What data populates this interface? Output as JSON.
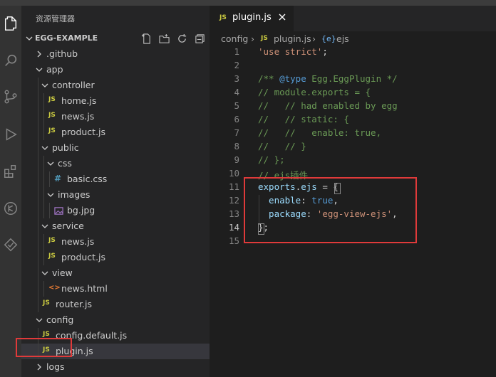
{
  "explorer": {
    "title": "资源管理器",
    "root": "EGG-EXAMPLE"
  },
  "tree": [
    {
      "name": ".github",
      "icon": "folder",
      "expanded": false,
      "depth": 0
    },
    {
      "name": "app",
      "icon": "folder",
      "expanded": true,
      "depth": 0
    },
    {
      "name": "controller",
      "icon": "folder",
      "expanded": true,
      "depth": 1
    },
    {
      "name": "home.js",
      "icon": "js",
      "depth": 2
    },
    {
      "name": "news.js",
      "icon": "js",
      "depth": 2
    },
    {
      "name": "product.js",
      "icon": "js",
      "depth": 2
    },
    {
      "name": "public",
      "icon": "folder",
      "expanded": true,
      "depth": 1
    },
    {
      "name": "css",
      "icon": "folder",
      "expanded": true,
      "depth": 2
    },
    {
      "name": "basic.css",
      "icon": "css",
      "depth": 3
    },
    {
      "name": "images",
      "icon": "folder",
      "expanded": true,
      "depth": 2
    },
    {
      "name": "bg.jpg",
      "icon": "image",
      "depth": 3
    },
    {
      "name": "service",
      "icon": "folder",
      "expanded": true,
      "depth": 1
    },
    {
      "name": "news.js",
      "icon": "js",
      "depth": 2
    },
    {
      "name": "product.js",
      "icon": "js",
      "depth": 2
    },
    {
      "name": "view",
      "icon": "folder",
      "expanded": true,
      "depth": 1
    },
    {
      "name": "news.html",
      "icon": "html",
      "depth": 2
    },
    {
      "name": "router.js",
      "icon": "js",
      "depth": 1
    },
    {
      "name": "config",
      "icon": "folder",
      "expanded": true,
      "depth": 0
    },
    {
      "name": "config.default.js",
      "icon": "js",
      "depth": 1
    },
    {
      "name": "plugin.js",
      "icon": "js",
      "depth": 1,
      "selected": true
    },
    {
      "name": "logs",
      "icon": "folder",
      "expanded": false,
      "depth": 0
    }
  ],
  "tab": {
    "js_badge": "JS",
    "name": "plugin.js"
  },
  "breadcrumb": {
    "folder": "config",
    "sep": "›",
    "js_badge": "JS",
    "file": "plugin.js",
    "symbol_icon": "{e}",
    "symbol": "ejs"
  },
  "code": [
    {
      "n": "1",
      "tokens": [
        {
          "t": "'use strict'",
          "c": "c-str"
        },
        {
          "t": ";",
          "c": "c-pn"
        }
      ]
    },
    {
      "n": "2",
      "tokens": []
    },
    {
      "n": "3",
      "tokens": [
        {
          "t": "/** ",
          "c": "c-com"
        },
        {
          "t": "@type",
          "c": "c-doc"
        },
        {
          "t": " Egg.EggPlugin */",
          "c": "c-com"
        }
      ]
    },
    {
      "n": "4",
      "tokens": [
        {
          "t": "// module.exports = {",
          "c": "c-com"
        }
      ]
    },
    {
      "n": "5",
      "tokens": [
        {
          "t": "//   // had enabled by egg",
          "c": "c-com"
        }
      ]
    },
    {
      "n": "6",
      "tokens": [
        {
          "t": "//   // static: {",
          "c": "c-com"
        }
      ]
    },
    {
      "n": "7",
      "tokens": [
        {
          "t": "//   //   enable: true,",
          "c": "c-com"
        }
      ]
    },
    {
      "n": "8",
      "tokens": [
        {
          "t": "//   // }",
          "c": "c-com"
        }
      ]
    },
    {
      "n": "9",
      "tokens": [
        {
          "t": "// };",
          "c": "c-com"
        }
      ]
    },
    {
      "n": "10",
      "tokens": [
        {
          "t": "// ejs插件",
          "c": "c-com"
        }
      ]
    },
    {
      "n": "11",
      "tokens": [
        {
          "t": "exports",
          "c": "c-var"
        },
        {
          "t": ".",
          "c": "c-pn"
        },
        {
          "t": "ejs",
          "c": "c-var"
        },
        {
          "t": " = {",
          "c": "c-pn"
        }
      ]
    },
    {
      "n": "12",
      "tokens": [
        {
          "t": "  enable",
          "c": "c-var"
        },
        {
          "t": ": ",
          "c": "c-pn"
        },
        {
          "t": "true",
          "c": "c-kw"
        },
        {
          "t": ",",
          "c": "c-pn"
        }
      ]
    },
    {
      "n": "13",
      "tokens": [
        {
          "t": "  package",
          "c": "c-var"
        },
        {
          "t": ": ",
          "c": "c-pn"
        },
        {
          "t": "'egg-view-ejs'",
          "c": "c-str"
        },
        {
          "t": ",",
          "c": "c-pn"
        }
      ]
    },
    {
      "n": "14",
      "tokens": [
        {
          "t": "};",
          "c": "c-pn"
        }
      ]
    },
    {
      "n": "15",
      "tokens": []
    }
  ],
  "current_line": "14",
  "colors": {
    "highlight_box": "#e03a3a",
    "js_icon": "#cbcb41",
    "string": "#ce9178",
    "comment": "#6a9955"
  }
}
